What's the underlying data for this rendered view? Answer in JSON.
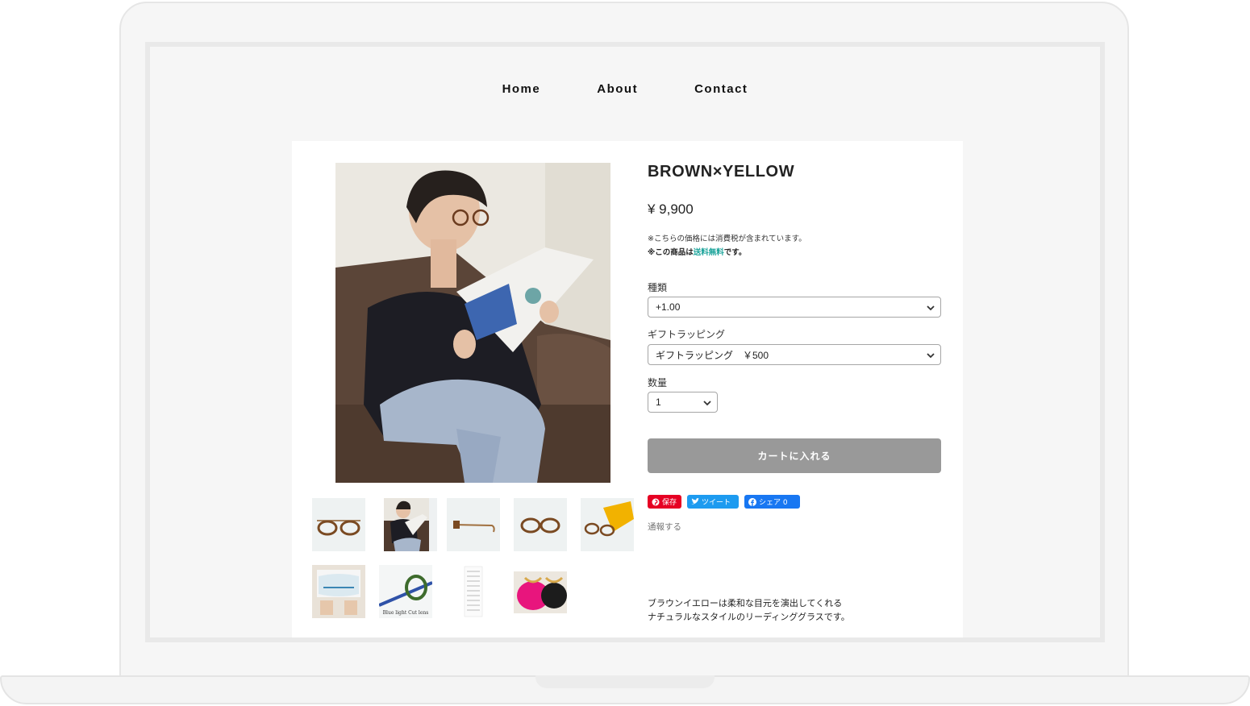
{
  "nav": {
    "home": "Home",
    "about": "About",
    "contact": "Contact"
  },
  "product": {
    "title": "BROWN×YELLOW",
    "price": "¥ 9,900",
    "tax_note": "※こちらの価格には消費税が含まれています。",
    "shipping_prefix": "※この商品は",
    "shipping_free": "送料無料",
    "shipping_suffix": "です。",
    "description_line1": "ブラウンイエローは柔和な目元を演出してくれる",
    "description_line2": "ナチュラルなスタイルのリーディンググラスです。"
  },
  "options": {
    "type_label": "種類",
    "type_value": "+1.00",
    "gift_label": "ギフトラッピング",
    "gift_value": "ギフトラッピング　￥500",
    "qty_label": "数量",
    "qty_value": "1"
  },
  "cart": {
    "label": "カートに入れる"
  },
  "social": {
    "pin": "保存",
    "tweet": "ツイート",
    "share": "シェア 0"
  },
  "report": {
    "label": "通報する"
  },
  "thumbnails": {
    "blue_light_text": "Blue light Cut lens"
  },
  "colors": {
    "accent_free": "#1aa39a",
    "cart_button": "#999999",
    "pinterest": "#e60023",
    "twitter": "#1d9bf0",
    "facebook": "#1877f2"
  }
}
